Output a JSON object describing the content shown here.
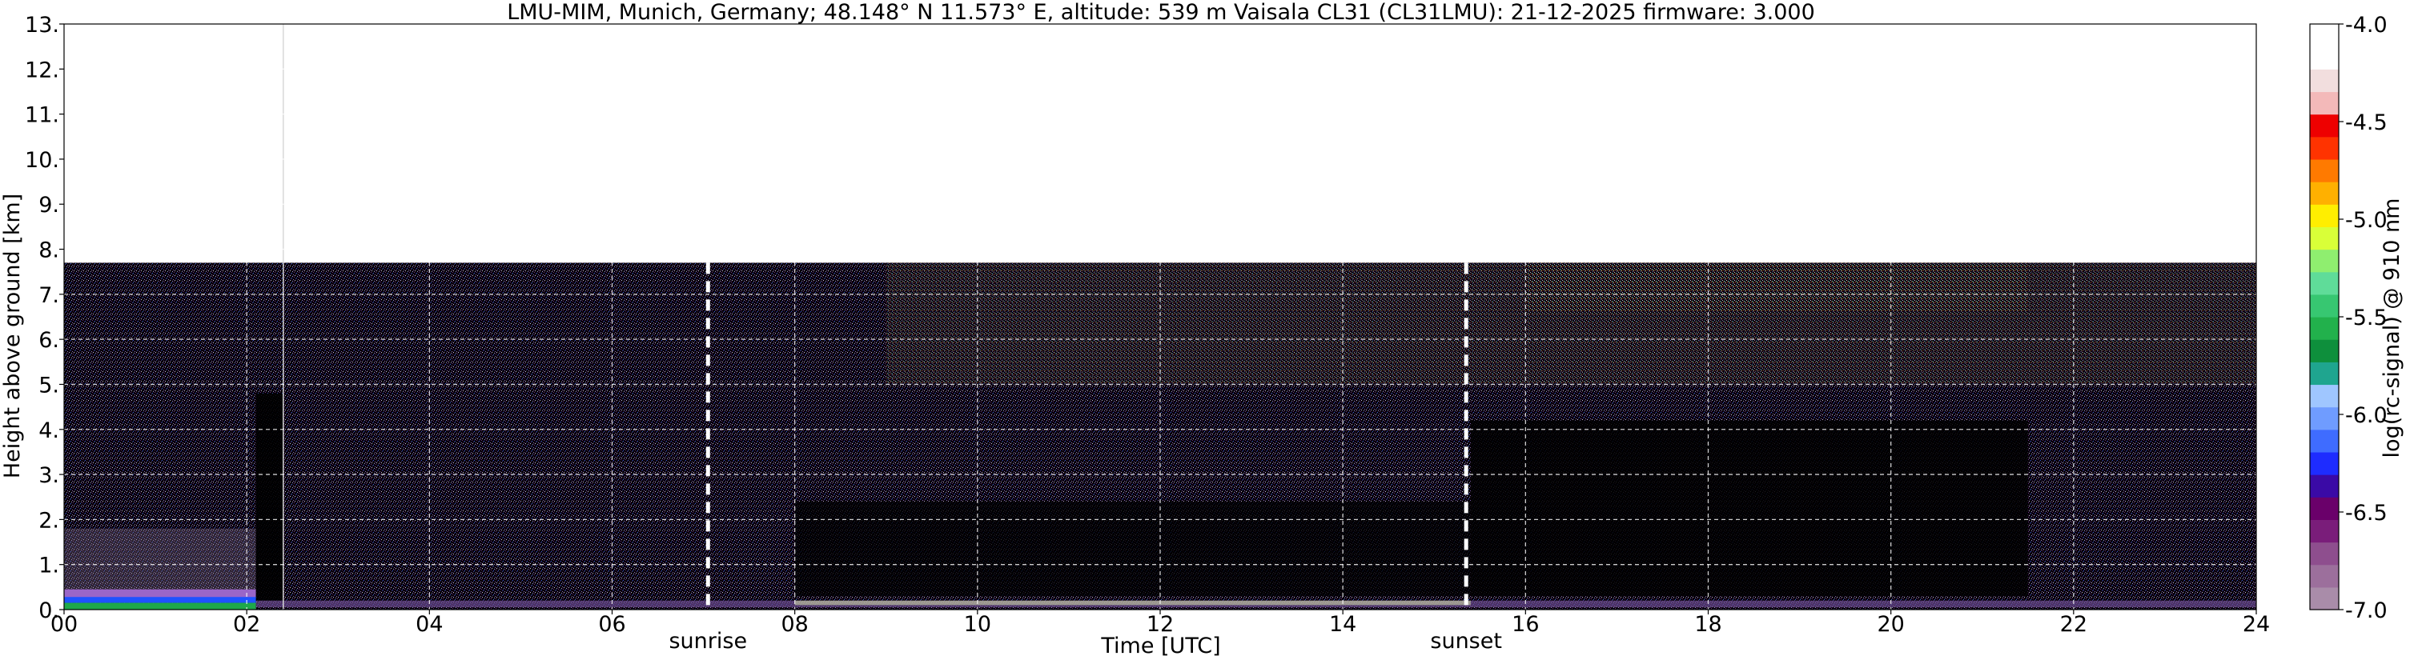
{
  "chart_data": {
    "type": "heatmap",
    "title": "LMU-MIM, Munich, Germany; 48.148° N 11.573° E, altitude: 539 m    Vaisala CL31 (CL31LMU): 21-12-2025    firmware: 3.000",
    "xlabel": "Time [UTC]",
    "ylabel": "Height above ground [km]",
    "xlim": [
      0,
      24
    ],
    "ylim": [
      0,
      13
    ],
    "x_ticks": [
      {
        "v": 0,
        "label": "00"
      },
      {
        "v": 2,
        "label": "02"
      },
      {
        "v": 4,
        "label": "04"
      },
      {
        "v": 6,
        "label": "06"
      },
      {
        "v": 8,
        "label": "08"
      },
      {
        "v": 10,
        "label": "10"
      },
      {
        "v": 12,
        "label": "12"
      },
      {
        "v": 14,
        "label": "14"
      },
      {
        "v": 16,
        "label": "16"
      },
      {
        "v": 18,
        "label": "18"
      },
      {
        "v": 20,
        "label": "20"
      },
      {
        "v": 22,
        "label": "22"
      },
      {
        "v": 24,
        "label": "24"
      }
    ],
    "y_ticks": [
      {
        "v": 0,
        "label": "0."
      },
      {
        "v": 1,
        "label": "1."
      },
      {
        "v": 2,
        "label": "2."
      },
      {
        "v": 3,
        "label": "3."
      },
      {
        "v": 4,
        "label": "4."
      },
      {
        "v": 5,
        "label": "5."
      },
      {
        "v": 6,
        "label": "6."
      },
      {
        "v": 7,
        "label": "7."
      },
      {
        "v": 8,
        "label": "8."
      },
      {
        "v": 9,
        "label": "9."
      },
      {
        "v": 10,
        "label": "10."
      },
      {
        "v": 11,
        "label": "11."
      },
      {
        "v": 12,
        "label": "12."
      },
      {
        "v": 13,
        "label": "13."
      }
    ],
    "grid": true,
    "data_top_km": 7.7,
    "instrument_gap_time_utc": 2.4,
    "markers": [
      {
        "label": "sunrise",
        "time_utc": 7.05
      },
      {
        "label": "sunset",
        "time_utc": 15.35
      }
    ],
    "colorbar": {
      "label": "log(rc-signal) @ 910 nm",
      "min": -7.0,
      "max": -4.0,
      "ticks": [
        {
          "v": -4.0,
          "label": "-4.0"
        },
        {
          "v": -4.5,
          "label": "-4.5"
        },
        {
          "v": -5.0,
          "label": "-5.0"
        },
        {
          "v": -5.5,
          "label": "-5.5"
        },
        {
          "v": -6.0,
          "label": "-6.0"
        },
        {
          "v": -6.5,
          "label": "-6.5"
        },
        {
          "v": -7.0,
          "label": "-7.0"
        }
      ],
      "colors_low_to_high": [
        "#a98ca9",
        "#9c6f9c",
        "#8e4e8e",
        "#7a1d7a",
        "#6a006a",
        "#3a0aa6",
        "#1e2cff",
        "#3f6cff",
        "#6f9cff",
        "#9fc6ff",
        "#1fa58f",
        "#0e8f3c",
        "#22b14c",
        "#37c771",
        "#5fdc99",
        "#8fee6f",
        "#d9ff38",
        "#ffee00",
        "#ffb000",
        "#ff7a00",
        "#ff3300",
        "#ee0000",
        "#f3b9b9",
        "#f2dede",
        "#ffffff",
        "#ffffff"
      ]
    }
  }
}
